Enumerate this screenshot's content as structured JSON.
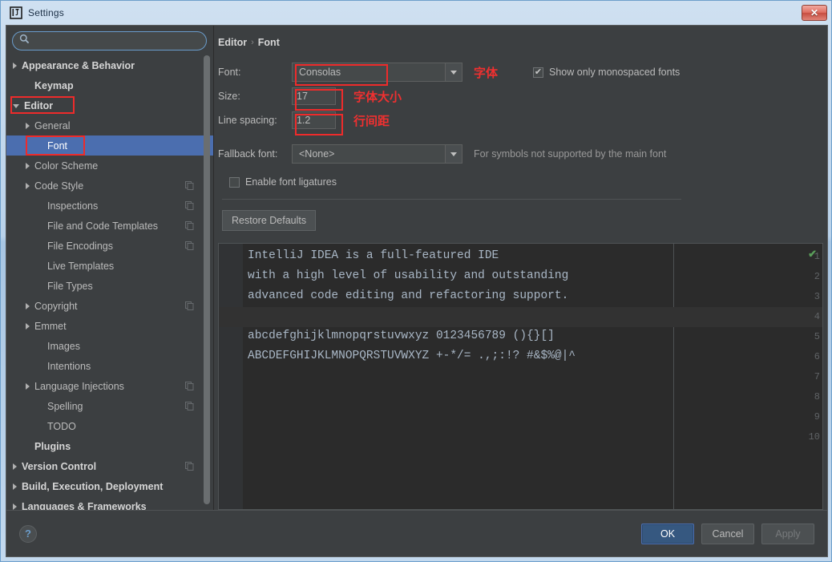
{
  "window": {
    "title": "Settings",
    "app_icon": "intellij-idea-icon",
    "close_label": "✕"
  },
  "sidebar": {
    "search": {
      "value": "",
      "placeholder": "",
      "icon": "search-icon"
    },
    "items": [
      {
        "label": "Appearance & Behavior",
        "arrow": "right",
        "bold": true,
        "indent": 0,
        "copy": false,
        "selected": false
      },
      {
        "label": "Keymap",
        "arrow": "none",
        "bold": true,
        "indent": 1,
        "copy": false,
        "selected": false
      },
      {
        "label": "Editor",
        "arrow": "down",
        "bold": true,
        "indent": 0,
        "copy": false,
        "selected": false
      },
      {
        "label": "General",
        "arrow": "right",
        "bold": false,
        "indent": 1,
        "copy": false,
        "selected": false
      },
      {
        "label": "Font",
        "arrow": "none",
        "bold": false,
        "indent": 2,
        "copy": false,
        "selected": true
      },
      {
        "label": "Color Scheme",
        "arrow": "right",
        "bold": false,
        "indent": 1,
        "copy": false,
        "selected": false
      },
      {
        "label": "Code Style",
        "arrow": "right",
        "bold": false,
        "indent": 1,
        "copy": true,
        "selected": false
      },
      {
        "label": "Inspections",
        "arrow": "none",
        "bold": false,
        "indent": 2,
        "copy": true,
        "selected": false
      },
      {
        "label": "File and Code Templates",
        "arrow": "none",
        "bold": false,
        "indent": 2,
        "copy": true,
        "selected": false
      },
      {
        "label": "File Encodings",
        "arrow": "none",
        "bold": false,
        "indent": 2,
        "copy": true,
        "selected": false
      },
      {
        "label": "Live Templates",
        "arrow": "none",
        "bold": false,
        "indent": 2,
        "copy": false,
        "selected": false
      },
      {
        "label": "File Types",
        "arrow": "none",
        "bold": false,
        "indent": 2,
        "copy": false,
        "selected": false
      },
      {
        "label": "Copyright",
        "arrow": "right",
        "bold": false,
        "indent": 1,
        "copy": true,
        "selected": false
      },
      {
        "label": "Emmet",
        "arrow": "right",
        "bold": false,
        "indent": 1,
        "copy": false,
        "selected": false
      },
      {
        "label": "Images",
        "arrow": "none",
        "bold": false,
        "indent": 2,
        "copy": false,
        "selected": false
      },
      {
        "label": "Intentions",
        "arrow": "none",
        "bold": false,
        "indent": 2,
        "copy": false,
        "selected": false
      },
      {
        "label": "Language Injections",
        "arrow": "right",
        "bold": false,
        "indent": 1,
        "copy": true,
        "selected": false
      },
      {
        "label": "Spelling",
        "arrow": "none",
        "bold": false,
        "indent": 2,
        "copy": true,
        "selected": false
      },
      {
        "label": "TODO",
        "arrow": "none",
        "bold": false,
        "indent": 2,
        "copy": false,
        "selected": false
      },
      {
        "label": "Plugins",
        "arrow": "none",
        "bold": true,
        "indent": 1,
        "copy": false,
        "selected": false
      },
      {
        "label": "Version Control",
        "arrow": "right",
        "bold": true,
        "indent": 0,
        "copy": true,
        "selected": false
      },
      {
        "label": "Build, Execution, Deployment",
        "arrow": "right",
        "bold": true,
        "indent": 0,
        "copy": false,
        "selected": false
      },
      {
        "label": "Languages & Frameworks",
        "arrow": "right",
        "bold": true,
        "indent": 0,
        "copy": false,
        "selected": false
      }
    ]
  },
  "panel": {
    "breadcrumb": {
      "parent": "Editor",
      "separator": "›",
      "current": "Font"
    },
    "font_label": "Font:",
    "font_value": "Consolas",
    "font_annotation": "字体",
    "monospaced_label": "Show only monospaced fonts",
    "monospaced_checked": true,
    "size_label": "Size:",
    "size_value": "17",
    "size_annotation": "字体大小",
    "line_spacing_label": "Line spacing:",
    "line_spacing_value": "1.2",
    "line_spacing_annotation": "行间距",
    "fallback_label": "Fallback font:",
    "fallback_value": "<None>",
    "fallback_hint": "For symbols not supported by the main font",
    "ligatures_label": "Enable font ligatures",
    "ligatures_checked": false,
    "restore_defaults_label": "Restore Defaults"
  },
  "preview": {
    "line_numbers": [
      "1",
      "2",
      "3",
      "4",
      "5",
      "6",
      "7",
      "8",
      "9",
      "10"
    ],
    "lines": [
      "IntelliJ IDEA is a full-featured IDE",
      "with a high level of usability and outstanding",
      "advanced code editing and refactoring support.",
      "",
      "abcdefghijklmnopqrstuvwxyz 0123456789 (){}[]",
      "ABCDEFGHIJKLMNOPQRSTUVWXYZ +-*/= .,;:!? #&$%@|^"
    ],
    "status_icon": "green-check-icon"
  },
  "footer": {
    "help_label": "?",
    "ok_label": "OK",
    "cancel_label": "Cancel",
    "apply_label": "Apply"
  },
  "colors": {
    "accent_selection": "#4b6eaf",
    "annotation_red": "#ee2b2b",
    "panel_bg": "#3c3f41",
    "editor_bg": "#2b2b2b",
    "code_fg": "#a9b7c6",
    "ok_button": "#365880",
    "status_green": "#5a9e5a"
  }
}
